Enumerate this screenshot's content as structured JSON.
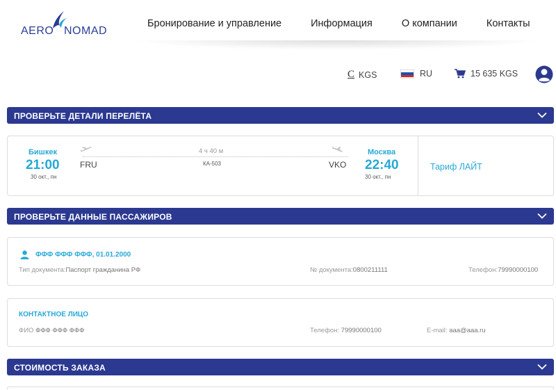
{
  "logo": {
    "part1": "AERO",
    "part2": "NOMAD"
  },
  "nav": {
    "items": [
      {
        "label": "Бронирование и управление"
      },
      {
        "label": "Информация"
      },
      {
        "label": "О компании"
      },
      {
        "label": "Контакты"
      }
    ]
  },
  "utility": {
    "currency_symbol": "С",
    "currency": "KGS",
    "language": "RU",
    "cart_total": "15 635 KGS"
  },
  "colors": {
    "primary": "#2b3990",
    "accent": "#27a9d6"
  },
  "icons": {
    "user": "user-circle-icon",
    "cart": "cart-icon",
    "chevron": "chevron-down-icon",
    "plane_takeoff": "plane-takeoff-icon",
    "plane_landing": "plane-landing-icon",
    "person": "person-icon"
  },
  "sections": {
    "flight": {
      "title": "ПРОВЕРЬТЕ ДЕТАЛИ ПЕРЕЛЁТА"
    },
    "passengers": {
      "title": "ПРОВЕРЬТЕ ДАННЫЕ ПАССАЖИРОВ"
    },
    "cost": {
      "title": "СТОИМОСТЬ ЗАКАЗА"
    }
  },
  "flight": {
    "departure": {
      "city": "Бишкек",
      "time": "21:00",
      "date": "30 окт., пн",
      "code": "FRU"
    },
    "arrival": {
      "city": "Москва",
      "time": "22:40",
      "date": "30 окт., пн",
      "code": "VKO"
    },
    "duration": "4 ч 40 м",
    "flight_number": "КА-503",
    "tariff": "Тариф ЛАЙТ"
  },
  "passenger": {
    "name": "ФФФ ФФФ ФФФ, 01.01.2000",
    "doc_type_label": "Тип документа:",
    "doc_type_value": "Паспорт гражданина РФ",
    "doc_number_label": "№ документа:",
    "doc_number_value": "0800211111",
    "phone_label": "Телефон:",
    "phone_value": "79990000100"
  },
  "contact": {
    "title": "КОНТАКТНОЕ ЛИЦО",
    "name_label": "ФИО",
    "name_value": "ФФФ ФФФ ФФФ",
    "phone_label": "Телефон:",
    "phone_value": "79990000100",
    "email_label": "E-mail:",
    "email_value": "aaa@aaa.ru"
  }
}
